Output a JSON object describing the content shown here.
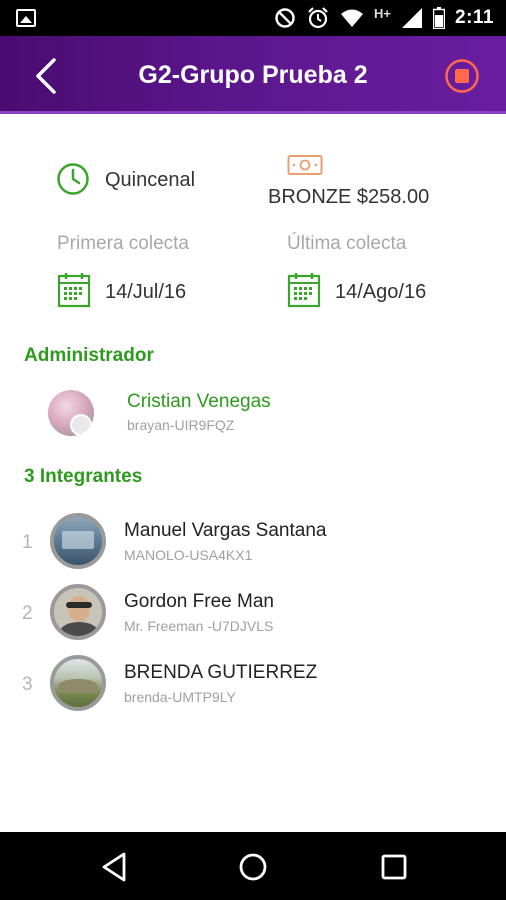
{
  "status_bar": {
    "network": "H+",
    "time": "2:11"
  },
  "header": {
    "title": "G2-Grupo Prueba 2"
  },
  "info": {
    "frequency": "Quincenal",
    "plan": "BRONZE $258.00",
    "first_collect_label": "Primera colecta",
    "first_collect_date": "14/Jul/16",
    "last_collect_label": "Última colecta",
    "last_collect_date": "14/Ago/16"
  },
  "admin": {
    "section_title": "Administrador",
    "name": "Cristian Venegas",
    "username": "brayan-UIR9FQZ"
  },
  "members": {
    "section_title": "3 Integrantes",
    "list": [
      {
        "number": "1",
        "name": "Manuel Vargas Santana",
        "username": "MANOLO-USA4KX1"
      },
      {
        "number": "2",
        "name": "Gordon Free Man",
        "username": "Mr. Freeman -U7DJVLS"
      },
      {
        "number": "3",
        "name": "BRENDA GUTIERREZ",
        "username": "brenda-UMTP9LY"
      }
    ]
  },
  "colors": {
    "accent_green": "#2e9a1e",
    "header_purple": "#5e1890",
    "stop_red": "#ff6a4a"
  }
}
